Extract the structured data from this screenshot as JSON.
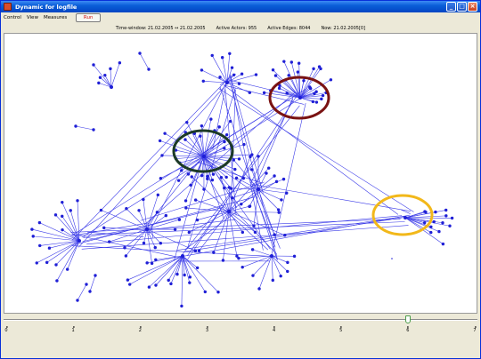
{
  "window": {
    "title": "Dynamic for logfile"
  },
  "titlebar_buttons": {
    "minimize": "_",
    "maximize": "□",
    "close": "×"
  },
  "menu": {
    "control": "Control",
    "view": "View",
    "measures": "Measures",
    "run": "Run"
  },
  "status": {
    "time_window": "Time-window: 21.02.2005 ↔ 21.02.2005",
    "active_actors": "Active Actors: 955",
    "active_edges": "Active Edges: 8044",
    "now": "Now: 21.02.2005[0]"
  },
  "timeline": {
    "ticks": [
      "0",
      "1",
      "2",
      "3",
      "4",
      "5",
      "6",
      "7"
    ],
    "position": 6.0,
    "max": 7
  },
  "colors": {
    "node": "#1f1fd6",
    "edge": "#3a3ae8",
    "highlight_dark_red": "#7a1212",
    "highlight_dark_green": "#1c3a26",
    "highlight_yellow": "#f2b81a"
  }
}
